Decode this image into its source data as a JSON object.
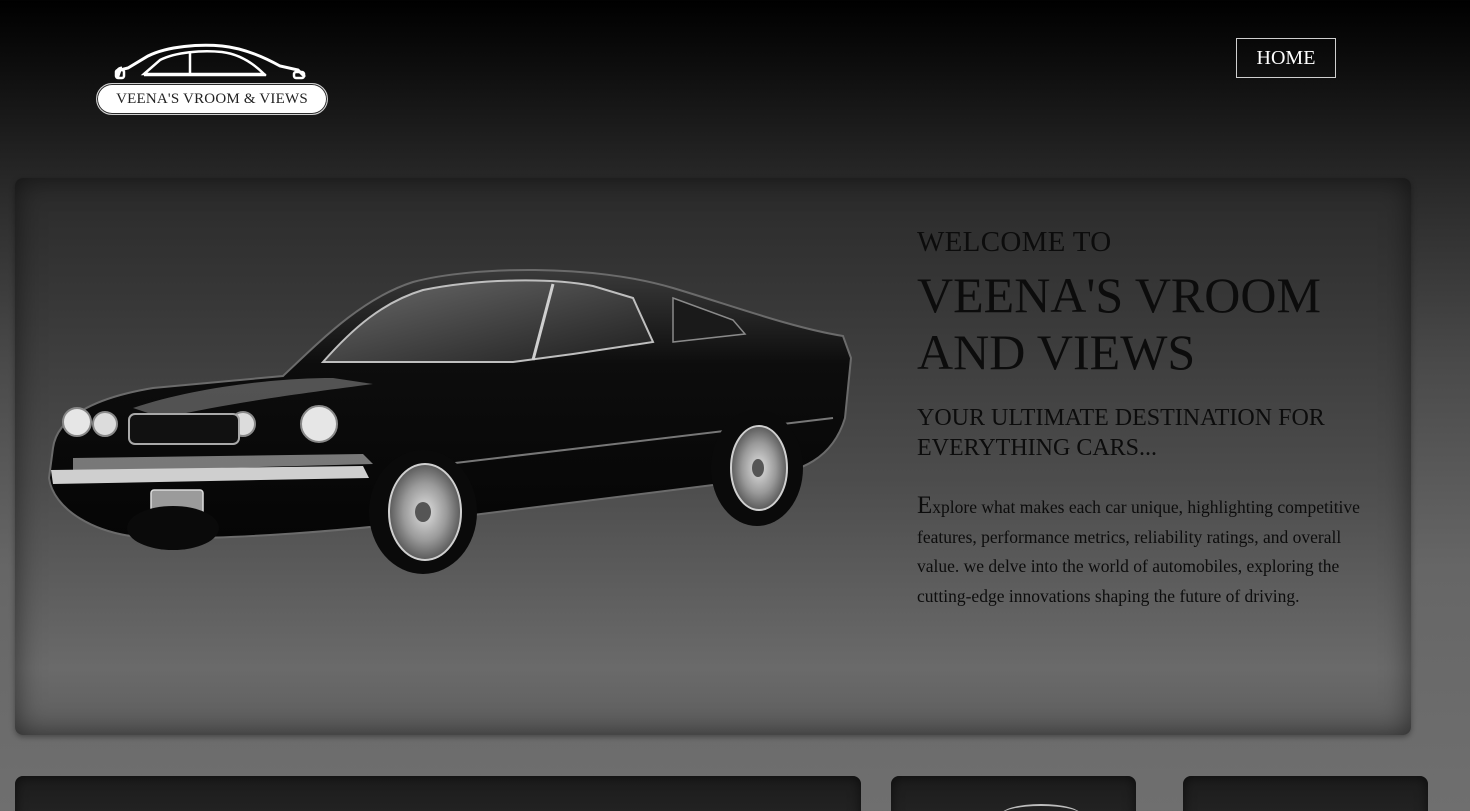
{
  "header": {
    "logo_text": "VEENA'S VROOM & VIEWS",
    "logo_icon": "car-outline-icon",
    "nav": [
      {
        "label": "HOME"
      }
    ]
  },
  "hero": {
    "image": "black-classic-muscle-car",
    "welcome": "WELCOME TO",
    "title_line1": "VEENA'S VROOM",
    "title_line2": "AND VIEWS",
    "tagline_line1": "YOUR ULTIMATE DESTINATION FOR",
    "tagline_line2": "EVERYTHING CARS...",
    "description_first_letter": "E",
    "description_rest": "xplore what makes each car unique, highlighting competitive features, performance metrics, reliability ratings, and overall value. we delve into the world of automobiles, exploring the cutting-edge innovations shaping the future of driving."
  },
  "colors": {
    "background_top": "#000000",
    "background_bottom": "#6f6f6f",
    "hero_text": "#0c0c0c",
    "nav_text": "#ffffff"
  }
}
